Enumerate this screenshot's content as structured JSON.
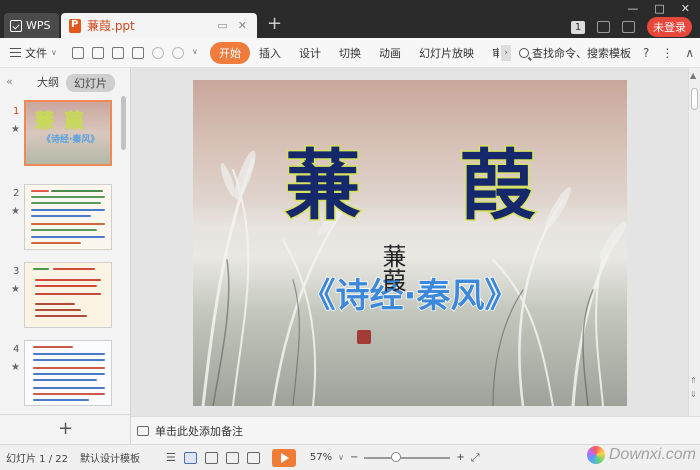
{
  "titlebar": {
    "app_tab": "WPS",
    "doc_tab": "蒹葭.ppt",
    "add_tab": "+",
    "badge_num": "1",
    "login": "未登录"
  },
  "toolbar": {
    "file_menu": "文件",
    "tabs": [
      "开始",
      "插入",
      "设计",
      "切换",
      "动画",
      "幻灯片放映",
      "审阅"
    ],
    "more": "›",
    "search": "查找命令、搜索模板",
    "help": "?",
    "more_dots": "⋮",
    "collapse": "∧"
  },
  "left_panel": {
    "collapse": "«",
    "tab_outline": "大纲",
    "tab_slides": "幻灯片",
    "thumbnails": [
      {
        "num": "1",
        "title": "蒹 葭",
        "subtitle": "《诗经·秦风》"
      },
      {
        "num": "2"
      },
      {
        "num": "3"
      },
      {
        "num": "4"
      }
    ],
    "add": "+"
  },
  "slide": {
    "title": "蒹 葭",
    "subtitle": "《诗经·秦风》",
    "calligraphy": "蒹葭"
  },
  "notes": {
    "placeholder": "单击此处添加备注"
  },
  "statusbar": {
    "slide_info": "幻灯片 1 / 22",
    "template": "默认设计模板",
    "zoom": "57%",
    "zoom_minus": "−",
    "zoom_plus": "+"
  },
  "watermark": {
    "text": "Downxi.com"
  },
  "colors": {
    "accent": "#ef7b3c",
    "title_text": "#15286b",
    "subtitle_text": "#3d88d8",
    "login": "#e8473b"
  }
}
